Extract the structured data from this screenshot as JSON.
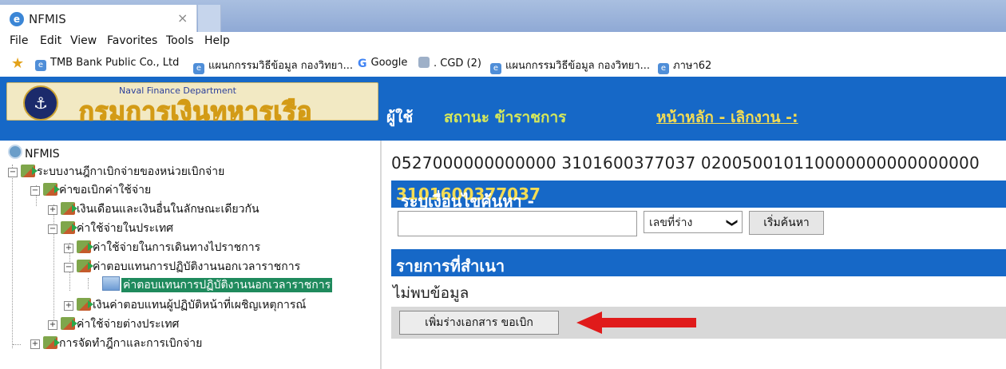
{
  "browser": {
    "tab_title": "NFMIS",
    "tab_close": "×",
    "menu": [
      "File",
      "Edit",
      "View",
      "Favorites",
      "Tools",
      "Help"
    ],
    "favorites": [
      {
        "label": "TMB Bank Public Co., Ltd",
        "icon": "ie-page-icon"
      },
      {
        "label": "แผนกกรรมวิธีข้อมูล กองวิทยา...",
        "icon": "ie-page-icon"
      },
      {
        "label": "Google",
        "icon": "google-icon"
      },
      {
        "label": ". CGD (2)",
        "icon": "image-icon"
      },
      {
        "label": "แผนกกรรมวิธีข้อมูล กองวิทยา...",
        "icon": "ie-page-icon"
      },
      {
        "label": "ภาษา62",
        "icon": "ie-page-icon"
      }
    ]
  },
  "header": {
    "logo_sub": "Naval Finance Department",
    "logo_main": "กรมการเงินทหารเรือ",
    "user_label": "ผู้ใช้",
    "status_label": "สถานะ ข้าราชการ",
    "nav_link": "หน้าหลัก - เลิกงาน -:",
    "color": "#1668c7"
  },
  "tree": {
    "root": "NFMIS",
    "nodes": [
      "ระบบงานฎีกาเบิกจ่ายของหน่วยเบิกจ่าย",
      "ค่าขอเบิกค่าใช้จ่าย",
      "เงินเดือนและเงินอื่นในลักษณะเดียวกัน",
      "ค่าใช้จ่ายในประเทศ",
      "ค่าใช้จ่ายในการเดินทางไปราชการ",
      "ค่าตอบแทนการปฏิบัติงานนอกเวลาราชการ",
      "ค่าตอบแทนการปฏิบัติงานนอกเวลาราชการ",
      "เงินค่าตอบแทนผู้ปฏิบัติหน้าที่เผชิญเหตุการณ์",
      "ค่าใช้จ่ายต่างประเทศ",
      "การจัดทำฎีกาและการเบิกจ่าย"
    ]
  },
  "main": {
    "doc_id": "0527000000000000 3101600377037 020050010110000000000000000",
    "search_title_prefix": "ระบุเงื่อนไขค้นหา -- รหัสผู้ทำรายการ ",
    "search_user_code": "3101600377037",
    "search_placeholder": "",
    "search_select": "เลขที่ร่าง",
    "search_button": "เริ่มค้นหา",
    "list_title": "รายการที่สำเนา",
    "no_data": "ไม่พบข้อมูล",
    "add_button": "เพิ่มร่างเอกสาร ขอเบิก"
  }
}
